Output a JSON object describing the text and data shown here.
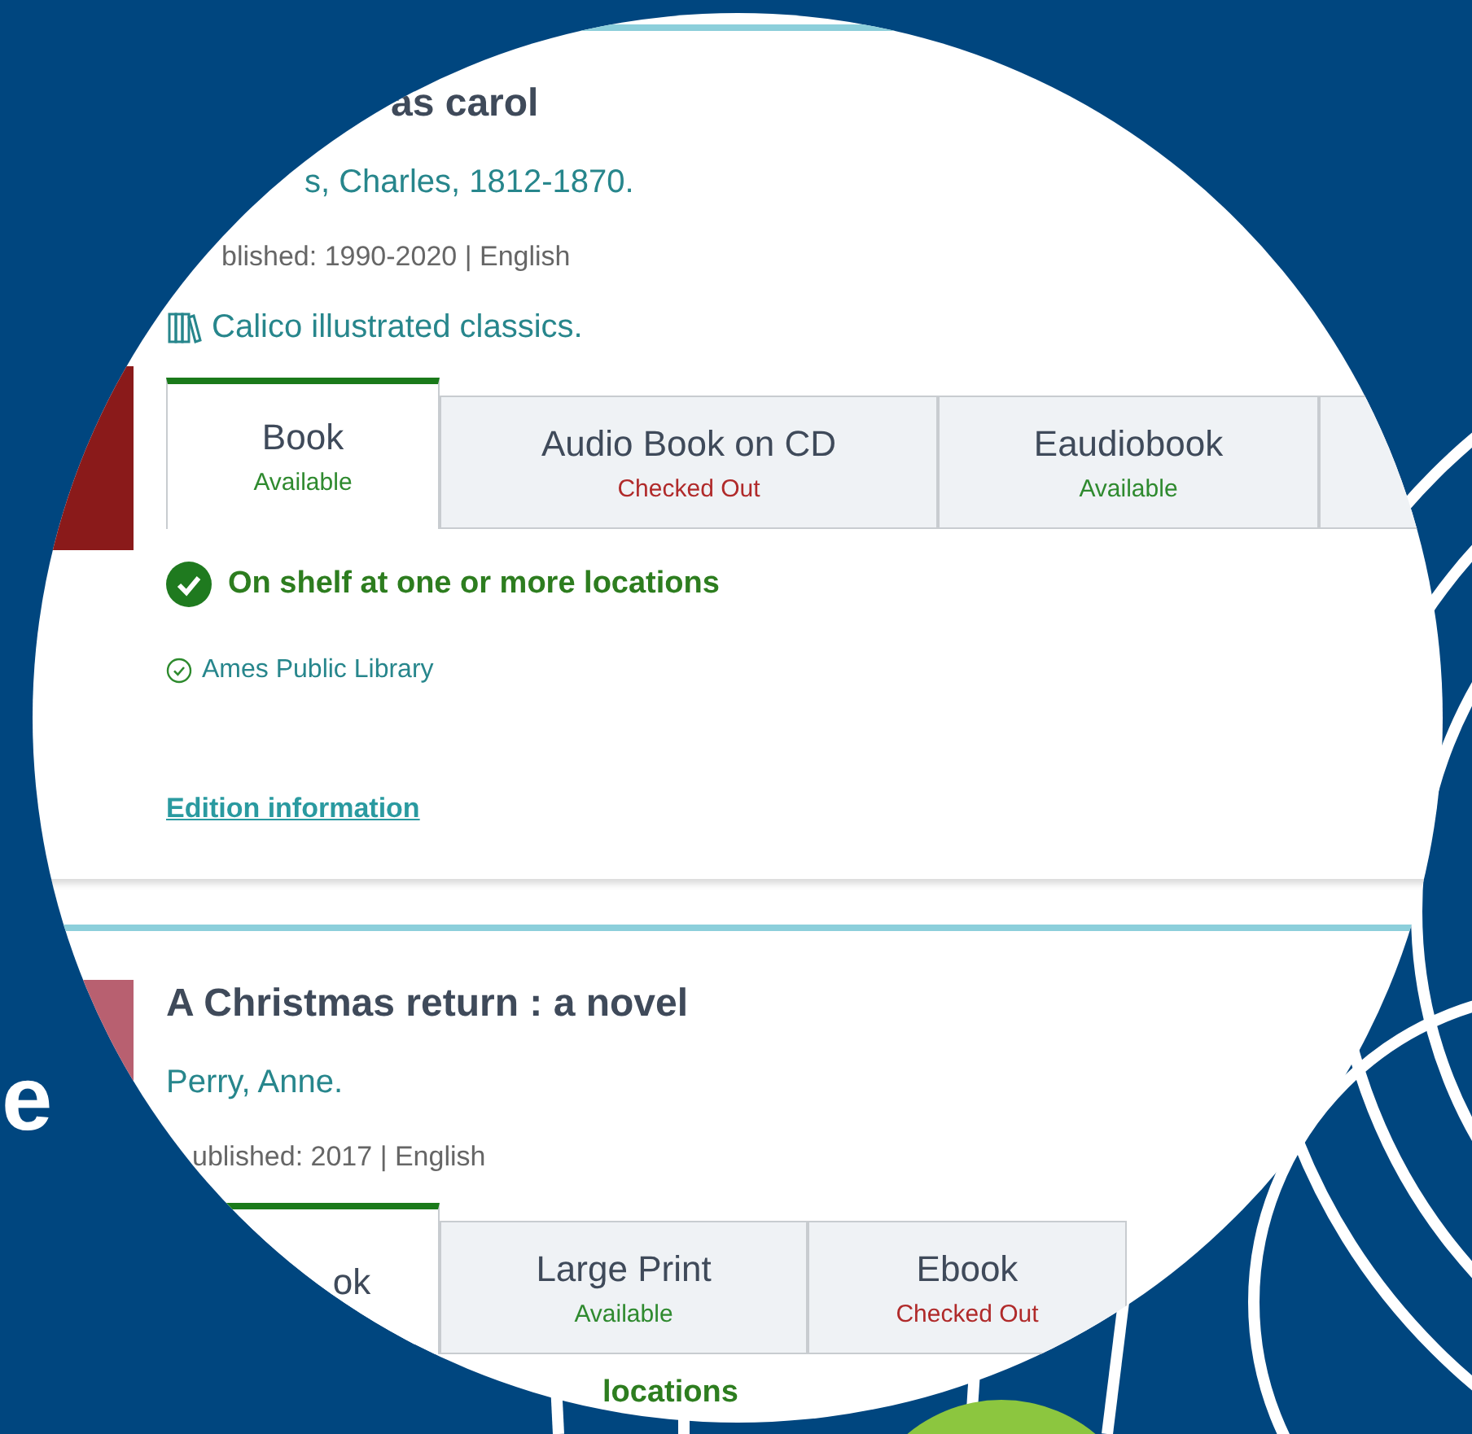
{
  "background_text": "e",
  "records": [
    {
      "title": "as carol",
      "author": "s, Charles, 1812-1870.",
      "published": "blished: 1990-2020 | English",
      "series": "Calico illustrated classics.",
      "cover": true,
      "formats": [
        {
          "label": "Book",
          "status": "Available",
          "available": true,
          "selected": true
        },
        {
          "label": "Audio Book on CD",
          "status": "Checked Out",
          "available": false,
          "selected": false
        },
        {
          "label": "Eaudiobook",
          "status": "Available",
          "available": true,
          "selected": false
        },
        {
          "selected": false
        }
      ],
      "availability": {
        "text": "On shelf at one or more locations",
        "check_icon": true
      },
      "locations": [
        "Ames Public Library"
      ],
      "edition_link": "Edition information"
    },
    {
      "title": "A Christmas return : a novel",
      "author": "Perry, Anne.",
      "published": "ublished: 2017 | English",
      "cover": true,
      "formats": [
        {
          "label": "ok",
          "selected": true
        },
        {
          "label": "Large Print",
          "status": "Available",
          "available": true,
          "selected": false
        },
        {
          "label": "Ebook",
          "status": "Checked Out",
          "available": false,
          "selected": false
        }
      ],
      "availability": {
        "text": "locations"
      }
    }
  ]
}
